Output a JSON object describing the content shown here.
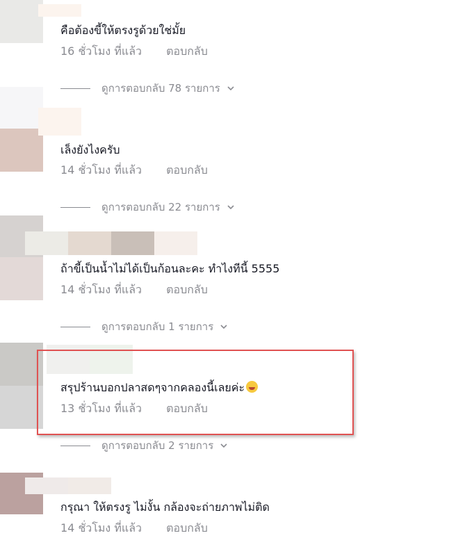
{
  "comments": [
    {
      "text": "คือต้องขี้ให้ตรงรูด้วยใช่มั้ย",
      "time": "16 ชั่วโมง ที่แล้ว",
      "reply_label": "ตอบกลับ",
      "view_replies": "ดูการตอบกลับ 78 รายการ"
    },
    {
      "text": "เล็งยังไงครับ",
      "time": "14 ชั่วโมง ที่แล้ว",
      "reply_label": "ตอบกลับ",
      "view_replies": "ดูการตอบกลับ 22 รายการ"
    },
    {
      "text": "ถ้าขี้เป็นน้ำไม่ได้เป็นก้อนละคะ ทำไงทีนี้ 5555",
      "time": "14 ชั่วโมง ที่แล้ว",
      "reply_label": "ตอบกลับ",
      "view_replies": "ดูการตอบกลับ 1 รายการ"
    },
    {
      "text": "สรุปร้านบอกปลาสดๆจากคลองนี้เลยค่ะ",
      "emoji": "laughing-face",
      "time": "13 ชั่วโมง ที่แล้ว",
      "reply_label": "ตอบกลับ",
      "view_replies": "ดูการตอบกลับ 2 รายการ"
    },
    {
      "text": "กรุณา ให้ตรงรู ไม่งั้น กล้องจะถ่ายภาพไม่ติด",
      "time": "14 ชั่วโมง ที่แล้ว",
      "reply_label": "ตอบกลับ"
    }
  ],
  "colors": {
    "text": "#161823",
    "muted": "#8a8b91",
    "highlight_border": "#e05252"
  },
  "icons": {
    "chevron": "chevron-down-icon"
  }
}
